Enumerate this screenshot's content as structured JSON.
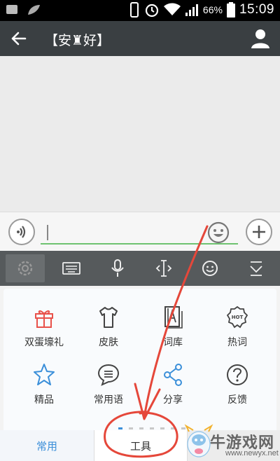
{
  "status_bar": {
    "battery_text": "66%",
    "time": "15:09"
  },
  "header": {
    "title": "【安♜好】"
  },
  "input": {
    "placeholder": ""
  },
  "keyboard_toolbar": {
    "items": [
      "settings-icon",
      "keyboard-icon",
      "microphone-icon",
      "cursor-icon",
      "emoji-icon",
      "collapse-icon"
    ]
  },
  "tools_panel": {
    "items": [
      {
        "label": "双蛋壕礼",
        "icon": "gift-icon",
        "color": "#e8514a"
      },
      {
        "label": "皮肤",
        "icon": "shirt-icon",
        "color": "#444444"
      },
      {
        "label": "词库",
        "icon": "dictionary-icon",
        "color": "#444444"
      },
      {
        "label": "热词",
        "icon": "hot-words-icon",
        "color": "#444444"
      },
      {
        "label": "精品",
        "icon": "star-icon",
        "color": "#3b8fd9"
      },
      {
        "label": "常用语",
        "icon": "chat-list-icon",
        "color": "#444444"
      },
      {
        "label": "分享",
        "icon": "share-icon",
        "color": "#3b8fd9"
      },
      {
        "label": "反馈",
        "icon": "question-icon",
        "color": "#444444"
      }
    ],
    "tabs": [
      "常用",
      "工具"
    ],
    "active_tab": "常用"
  },
  "watermark": {
    "text": "牛游戏网",
    "url": "www.newyx.net"
  }
}
